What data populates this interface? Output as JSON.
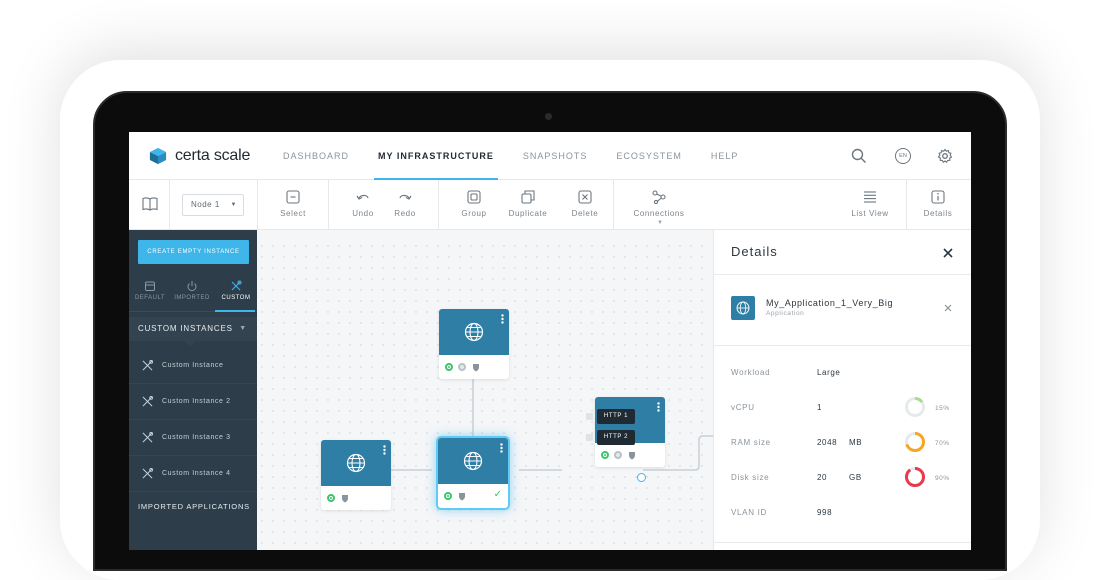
{
  "app": {
    "brand": "certa scale"
  },
  "nav": {
    "items": [
      "DASHBOARD",
      "MY INFRASTRUCTURE",
      "SNAPSHOTS",
      "ECOSYSTEM",
      "HELP"
    ]
  },
  "header_icons": {
    "search": "search-icon",
    "language": "EN",
    "settings": "gear-icon"
  },
  "toolbar": {
    "node_select": "Node 1",
    "buttons": {
      "select": "Select",
      "undo": "Undo",
      "redo": "Redo",
      "group": "Group",
      "duplicate": "Duplicate",
      "delete": "Delete",
      "connections": "Connections",
      "list_view": "List View",
      "details": "Details"
    }
  },
  "sidebar": {
    "create_button": "CREATE EMPTY INSTANCE",
    "tabs": [
      "DEFAULT",
      "IMPORTED",
      "CUSTOM"
    ],
    "active_tab": "CUSTOM",
    "section_title": "CUSTOM INSTANCES",
    "items": [
      "Custom Instance",
      "Custom Instance 2",
      "Custom Instance 3",
      "Custom Instance 4"
    ],
    "imported_title": "IMPORTED APPLICATIONS"
  },
  "canvas": {
    "http_labels": [
      "HTTP 1",
      "HTTP 2"
    ]
  },
  "details": {
    "title": "Details",
    "app_name": "My_Application_1_Very_Big",
    "app_type": "Application",
    "props": {
      "workload": {
        "label": "Workload",
        "value": "Large"
      },
      "vcpu": {
        "label": "vCPU",
        "value": "1",
        "percent": "15%",
        "fill": 0.15,
        "color": "#9fe08a"
      },
      "ram": {
        "label": "RAM size",
        "value": "2048",
        "unit": "MB",
        "percent": "70%",
        "fill": 0.7,
        "color": "#f5a623"
      },
      "disk": {
        "label": "Disk size",
        "value": "20",
        "unit": "GB",
        "percent": "90%",
        "fill": 0.9,
        "color": "#e8394d"
      },
      "vlan": {
        "label": "VLAN ID",
        "value": "998"
      }
    }
  },
  "colors": {
    "accent": "#3fb6ea",
    "node": "#2e7ea5",
    "sidebar": "#2d3d49",
    "ok": "#3cc46b"
  }
}
